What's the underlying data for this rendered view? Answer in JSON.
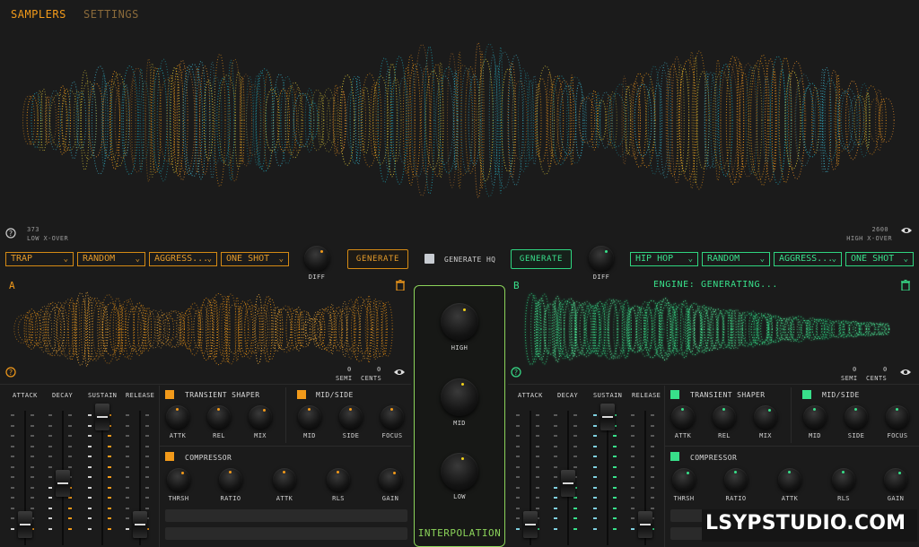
{
  "nav": {
    "tabs": [
      "SAMPLERS",
      "SETTINGS"
    ],
    "active": "SAMPLERS"
  },
  "colors": {
    "orange": "#f29a1a",
    "green": "#38e08a",
    "teal": "#1fa0b0",
    "yellow": "#e5cf3a",
    "bg": "#1b1b1b"
  },
  "crossover": {
    "low_value": "373",
    "low_label": "LOW X-OVER",
    "high_value": "2600",
    "high_label": "HIGH X-OVER"
  },
  "a": {
    "genre": "TRAP",
    "mode": "RANDOM",
    "style": "AGGRESS...",
    "type": "ONE SHOT",
    "diff_label": "DIFF",
    "generate_label": "GENERATE",
    "panel_letter": "A",
    "semi_value": "0",
    "cents_value": "0",
    "semi_label": "SEMI",
    "cents_label": "CENTS"
  },
  "b": {
    "genre": "HIP HOP",
    "mode": "RANDOM",
    "style": "AGGRESS...",
    "type": "ONE SHOT",
    "diff_label": "DIFF",
    "generate_label": "GENERATE",
    "panel_letter": "B",
    "semi_value": "0",
    "cents_value": "0",
    "semi_label": "SEMI",
    "cents_label": "CENTS",
    "status": "ENGINE: GENERATING..."
  },
  "generate_hq_label": "GENERATE HQ",
  "envelope": {
    "labels": [
      "ATTACK",
      "DECAY",
      "SUSTAIN",
      "RELEASE"
    ]
  },
  "transient": {
    "title": "TRANSIENT SHAPER",
    "knobs": [
      "ATTK",
      "REL",
      "MIX"
    ]
  },
  "midside": {
    "title": "MID/SIDE",
    "knobs": [
      "MID",
      "SIDE",
      "FOCUS"
    ]
  },
  "compressor": {
    "title": "COMPRESSOR",
    "knobs": [
      "THRSH",
      "RATIO",
      "ATTK",
      "RLS",
      "GAIN"
    ]
  },
  "interpolation": {
    "title": "INTERPOLATION",
    "knobs": [
      "HIGH",
      "MID",
      "LOW"
    ]
  },
  "watermark": "LSYPSTUDIO.COM",
  "icons": [
    "help-icon",
    "eye-icon",
    "trash-icon",
    "chevron-down-icon"
  ]
}
